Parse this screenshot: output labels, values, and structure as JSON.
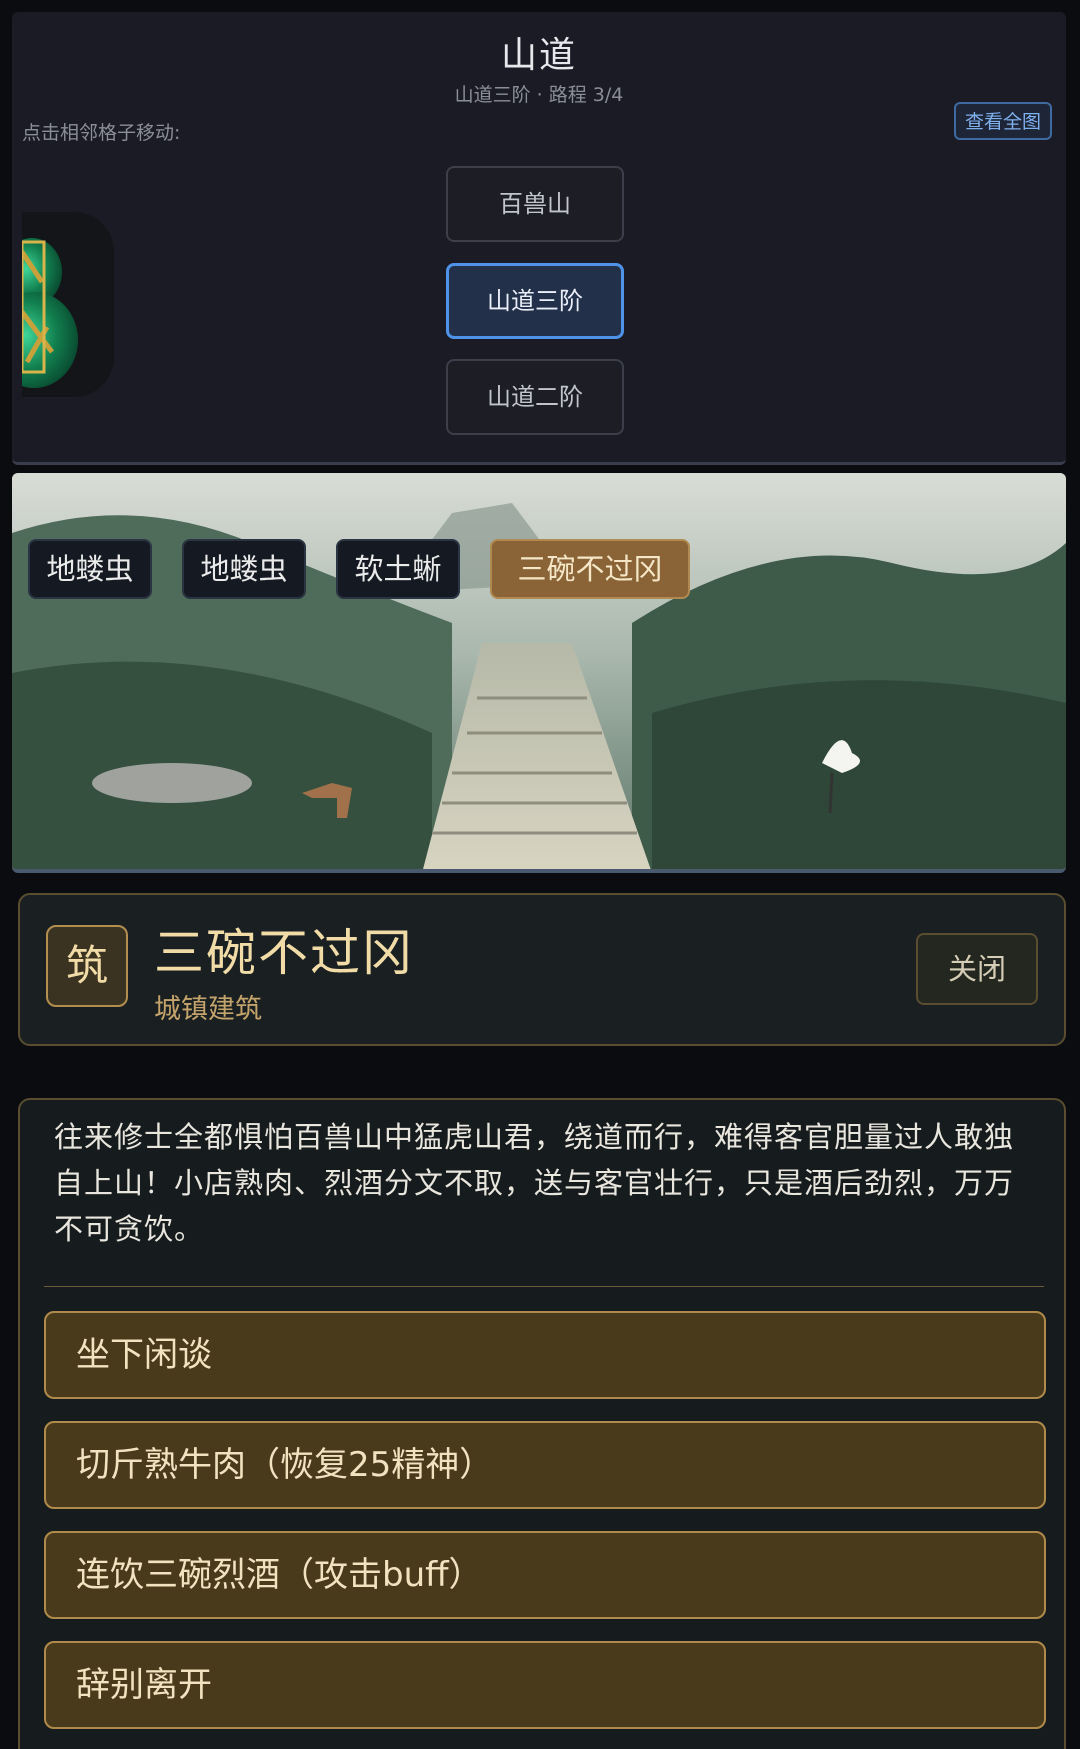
{
  "map": {
    "title": "山道",
    "subtitle": "山道三阶 · 路程 3/4",
    "hint": "点击相邻格子移动:",
    "view_map_label": "查看全图",
    "nodes": [
      {
        "label": "百兽山",
        "current": false
      },
      {
        "label": "山道三阶",
        "current": true
      },
      {
        "label": "山道二阶",
        "current": false
      }
    ]
  },
  "scene": {
    "tags": [
      {
        "label": "地蝼虫",
        "active": false
      },
      {
        "label": "地蝼虫",
        "active": false
      },
      {
        "label": "软土蜥",
        "active": false
      },
      {
        "label": "三碗不过冈",
        "active": true
      }
    ]
  },
  "building": {
    "icon_char": "筑",
    "name": "三碗不过冈",
    "type": "城镇建筑",
    "close_label": "关闭",
    "description": "往来修士全都惧怕百兽山中猛虎山君，绕道而行，难得客官胆量过人敢独自上山！小店熟肉、烈酒分文不取，送与客官壮行，只是酒后劲烈，万万不可贪饮。",
    "options": [
      {
        "label": "坐下闲谈"
      },
      {
        "label": "切斤熟牛肉（恢复25精神）"
      },
      {
        "label": "连饮三碗烈酒（攻击buff）"
      },
      {
        "label": "辞别离开"
      }
    ]
  },
  "colors": {
    "accent_blue": "#4f93e8",
    "gold": "#b08a4a",
    "active_tag": "#8a6336"
  }
}
